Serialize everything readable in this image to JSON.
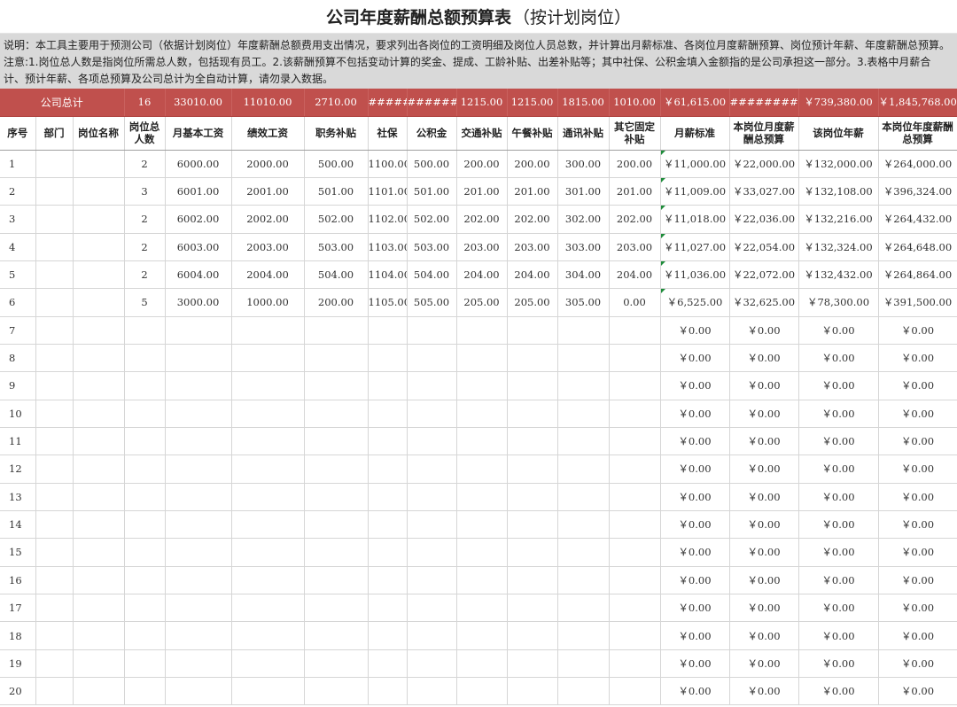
{
  "title": {
    "main": "公司年度薪酬总额预算表",
    "sub": "（按计划岗位）"
  },
  "note": "说明：本工具主要用于预测公司（依据计划岗位）年度薪酬总额费用支出情况，要求列出各岗位的工资明细及岗位人员总数，并计算出月薪标准、各岗位月度薪酬预算、岗位预计年薪、年度薪酬总预算。注意:1.岗位总人数是指岗位所需总人数，包括现有员工。2.该薪酬预算不包括变动计算的奖金、提成、工龄补贴、出差补贴等；其中社保、公积金填入金额指的是公司承担这一部分。3.表格中月薪合计、预计年薪、各项总预算及公司总计为全自动计算，请勿录入数据。",
  "totals": {
    "label": "公司总计",
    "headcount": "16",
    "base": "33010.00",
    "perf": "11010.00",
    "duty": "2710.00",
    "social": "#######",
    "fund": "#######",
    "transport": "1215.00",
    "lunch": "1215.00",
    "comm": "1815.00",
    "other": "1010.00",
    "monthly_std": "￥61,615.00",
    "monthly_budget": "###########",
    "annual_salary": "￥739,380.00",
    "annual_budget": "￥1,845,768.00"
  },
  "headers": {
    "idx": "序号",
    "dept": "部门",
    "position": "岗位名称",
    "headcount": "岗位总人数",
    "base": "月基本工资",
    "perf": "绩效工资",
    "duty": "职务补贴",
    "social": "社保",
    "fund": "公积金",
    "transport": "交通补贴",
    "lunch": "午餐补贴",
    "comm": "通讯补贴",
    "other": "其它固定补贴",
    "monthly_std": "月薪标准",
    "monthly_budget": "本岗位月度薪酬总预算",
    "annual_salary": "该岗位年薪",
    "annual_budget": "本岗位年度薪酬总预算"
  },
  "rows": [
    {
      "idx": "1",
      "dept": "",
      "position": "",
      "headcount": "2",
      "base": "6000.00",
      "perf": "2000.00",
      "duty": "500.00",
      "social": "1100.00",
      "fund": "500.00",
      "transport": "200.00",
      "lunch": "200.00",
      "comm": "300.00",
      "other": "200.00",
      "monthly_std": "￥11,000.00",
      "monthly_budget": "￥22,000.00",
      "annual_salary": "￥132,000.00",
      "annual_budget": "￥264,000.00"
    },
    {
      "idx": "2",
      "dept": "",
      "position": "",
      "headcount": "3",
      "base": "6001.00",
      "perf": "2001.00",
      "duty": "501.00",
      "social": "1101.00",
      "fund": "501.00",
      "transport": "201.00",
      "lunch": "201.00",
      "comm": "301.00",
      "other": "201.00",
      "monthly_std": "￥11,009.00",
      "monthly_budget": "￥33,027.00",
      "annual_salary": "￥132,108.00",
      "annual_budget": "￥396,324.00"
    },
    {
      "idx": "3",
      "dept": "",
      "position": "",
      "headcount": "2",
      "base": "6002.00",
      "perf": "2002.00",
      "duty": "502.00",
      "social": "1102.00",
      "fund": "502.00",
      "transport": "202.00",
      "lunch": "202.00",
      "comm": "302.00",
      "other": "202.00",
      "monthly_std": "￥11,018.00",
      "monthly_budget": "￥22,036.00",
      "annual_salary": "￥132,216.00",
      "annual_budget": "￥264,432.00"
    },
    {
      "idx": "4",
      "dept": "",
      "position": "",
      "headcount": "2",
      "base": "6003.00",
      "perf": "2003.00",
      "duty": "503.00",
      "social": "1103.00",
      "fund": "503.00",
      "transport": "203.00",
      "lunch": "203.00",
      "comm": "303.00",
      "other": "203.00",
      "monthly_std": "￥11,027.00",
      "monthly_budget": "￥22,054.00",
      "annual_salary": "￥132,324.00",
      "annual_budget": "￥264,648.00"
    },
    {
      "idx": "5",
      "dept": "",
      "position": "",
      "headcount": "2",
      "base": "6004.00",
      "perf": "2004.00",
      "duty": "504.00",
      "social": "1104.00",
      "fund": "504.00",
      "transport": "204.00",
      "lunch": "204.00",
      "comm": "304.00",
      "other": "204.00",
      "monthly_std": "￥11,036.00",
      "monthly_budget": "￥22,072.00",
      "annual_salary": "￥132,432.00",
      "annual_budget": "￥264,864.00"
    },
    {
      "idx": "6",
      "dept": "",
      "position": "",
      "headcount": "5",
      "base": "3000.00",
      "perf": "1000.00",
      "duty": "200.00",
      "social": "1105.00",
      "fund": "505.00",
      "transport": "205.00",
      "lunch": "205.00",
      "comm": "305.00",
      "other": "0.00",
      "monthly_std": "￥6,525.00",
      "monthly_budget": "￥32,625.00",
      "annual_salary": "￥78,300.00",
      "annual_budget": "￥391,500.00"
    },
    {
      "idx": "7",
      "monthly_std": "￥0.00",
      "monthly_budget": "￥0.00",
      "annual_salary": "￥0.00",
      "annual_budget": "￥0.00"
    },
    {
      "idx": "8",
      "monthly_std": "￥0.00",
      "monthly_budget": "￥0.00",
      "annual_salary": "￥0.00",
      "annual_budget": "￥0.00"
    },
    {
      "idx": "9",
      "monthly_std": "￥0.00",
      "monthly_budget": "￥0.00",
      "annual_salary": "￥0.00",
      "annual_budget": "￥0.00"
    },
    {
      "idx": "10",
      "monthly_std": "￥0.00",
      "monthly_budget": "￥0.00",
      "annual_salary": "￥0.00",
      "annual_budget": "￥0.00"
    },
    {
      "idx": "11",
      "monthly_std": "￥0.00",
      "monthly_budget": "￥0.00",
      "annual_salary": "￥0.00",
      "annual_budget": "￥0.00"
    },
    {
      "idx": "12",
      "monthly_std": "￥0.00",
      "monthly_budget": "￥0.00",
      "annual_salary": "￥0.00",
      "annual_budget": "￥0.00"
    },
    {
      "idx": "13",
      "monthly_std": "￥0.00",
      "monthly_budget": "￥0.00",
      "annual_salary": "￥0.00",
      "annual_budget": "￥0.00"
    },
    {
      "idx": "14",
      "monthly_std": "￥0.00",
      "monthly_budget": "￥0.00",
      "annual_salary": "￥0.00",
      "annual_budget": "￥0.00"
    },
    {
      "idx": "15",
      "monthly_std": "￥0.00",
      "monthly_budget": "￥0.00",
      "annual_salary": "￥0.00",
      "annual_budget": "￥0.00"
    },
    {
      "idx": "16",
      "monthly_std": "￥0.00",
      "monthly_budget": "￥0.00",
      "annual_salary": "￥0.00",
      "annual_budget": "￥0.00"
    },
    {
      "idx": "17",
      "monthly_std": "￥0.00",
      "monthly_budget": "￥0.00",
      "annual_salary": "￥0.00",
      "annual_budget": "￥0.00"
    },
    {
      "idx": "18",
      "monthly_std": "￥0.00",
      "monthly_budget": "￥0.00",
      "annual_salary": "￥0.00",
      "annual_budget": "￥0.00"
    },
    {
      "idx": "19",
      "monthly_std": "￥0.00",
      "monthly_budget": "￥0.00",
      "annual_salary": "￥0.00",
      "annual_budget": "￥0.00"
    },
    {
      "idx": "20",
      "monthly_std": "￥0.00",
      "monthly_budget": "￥0.00",
      "annual_salary": "￥0.00",
      "annual_budget": "￥0.00"
    }
  ],
  "colors": {
    "total_bg": "#c0504d",
    "note_bg": "#d9d9d9",
    "flag": "#1e8c3a"
  }
}
